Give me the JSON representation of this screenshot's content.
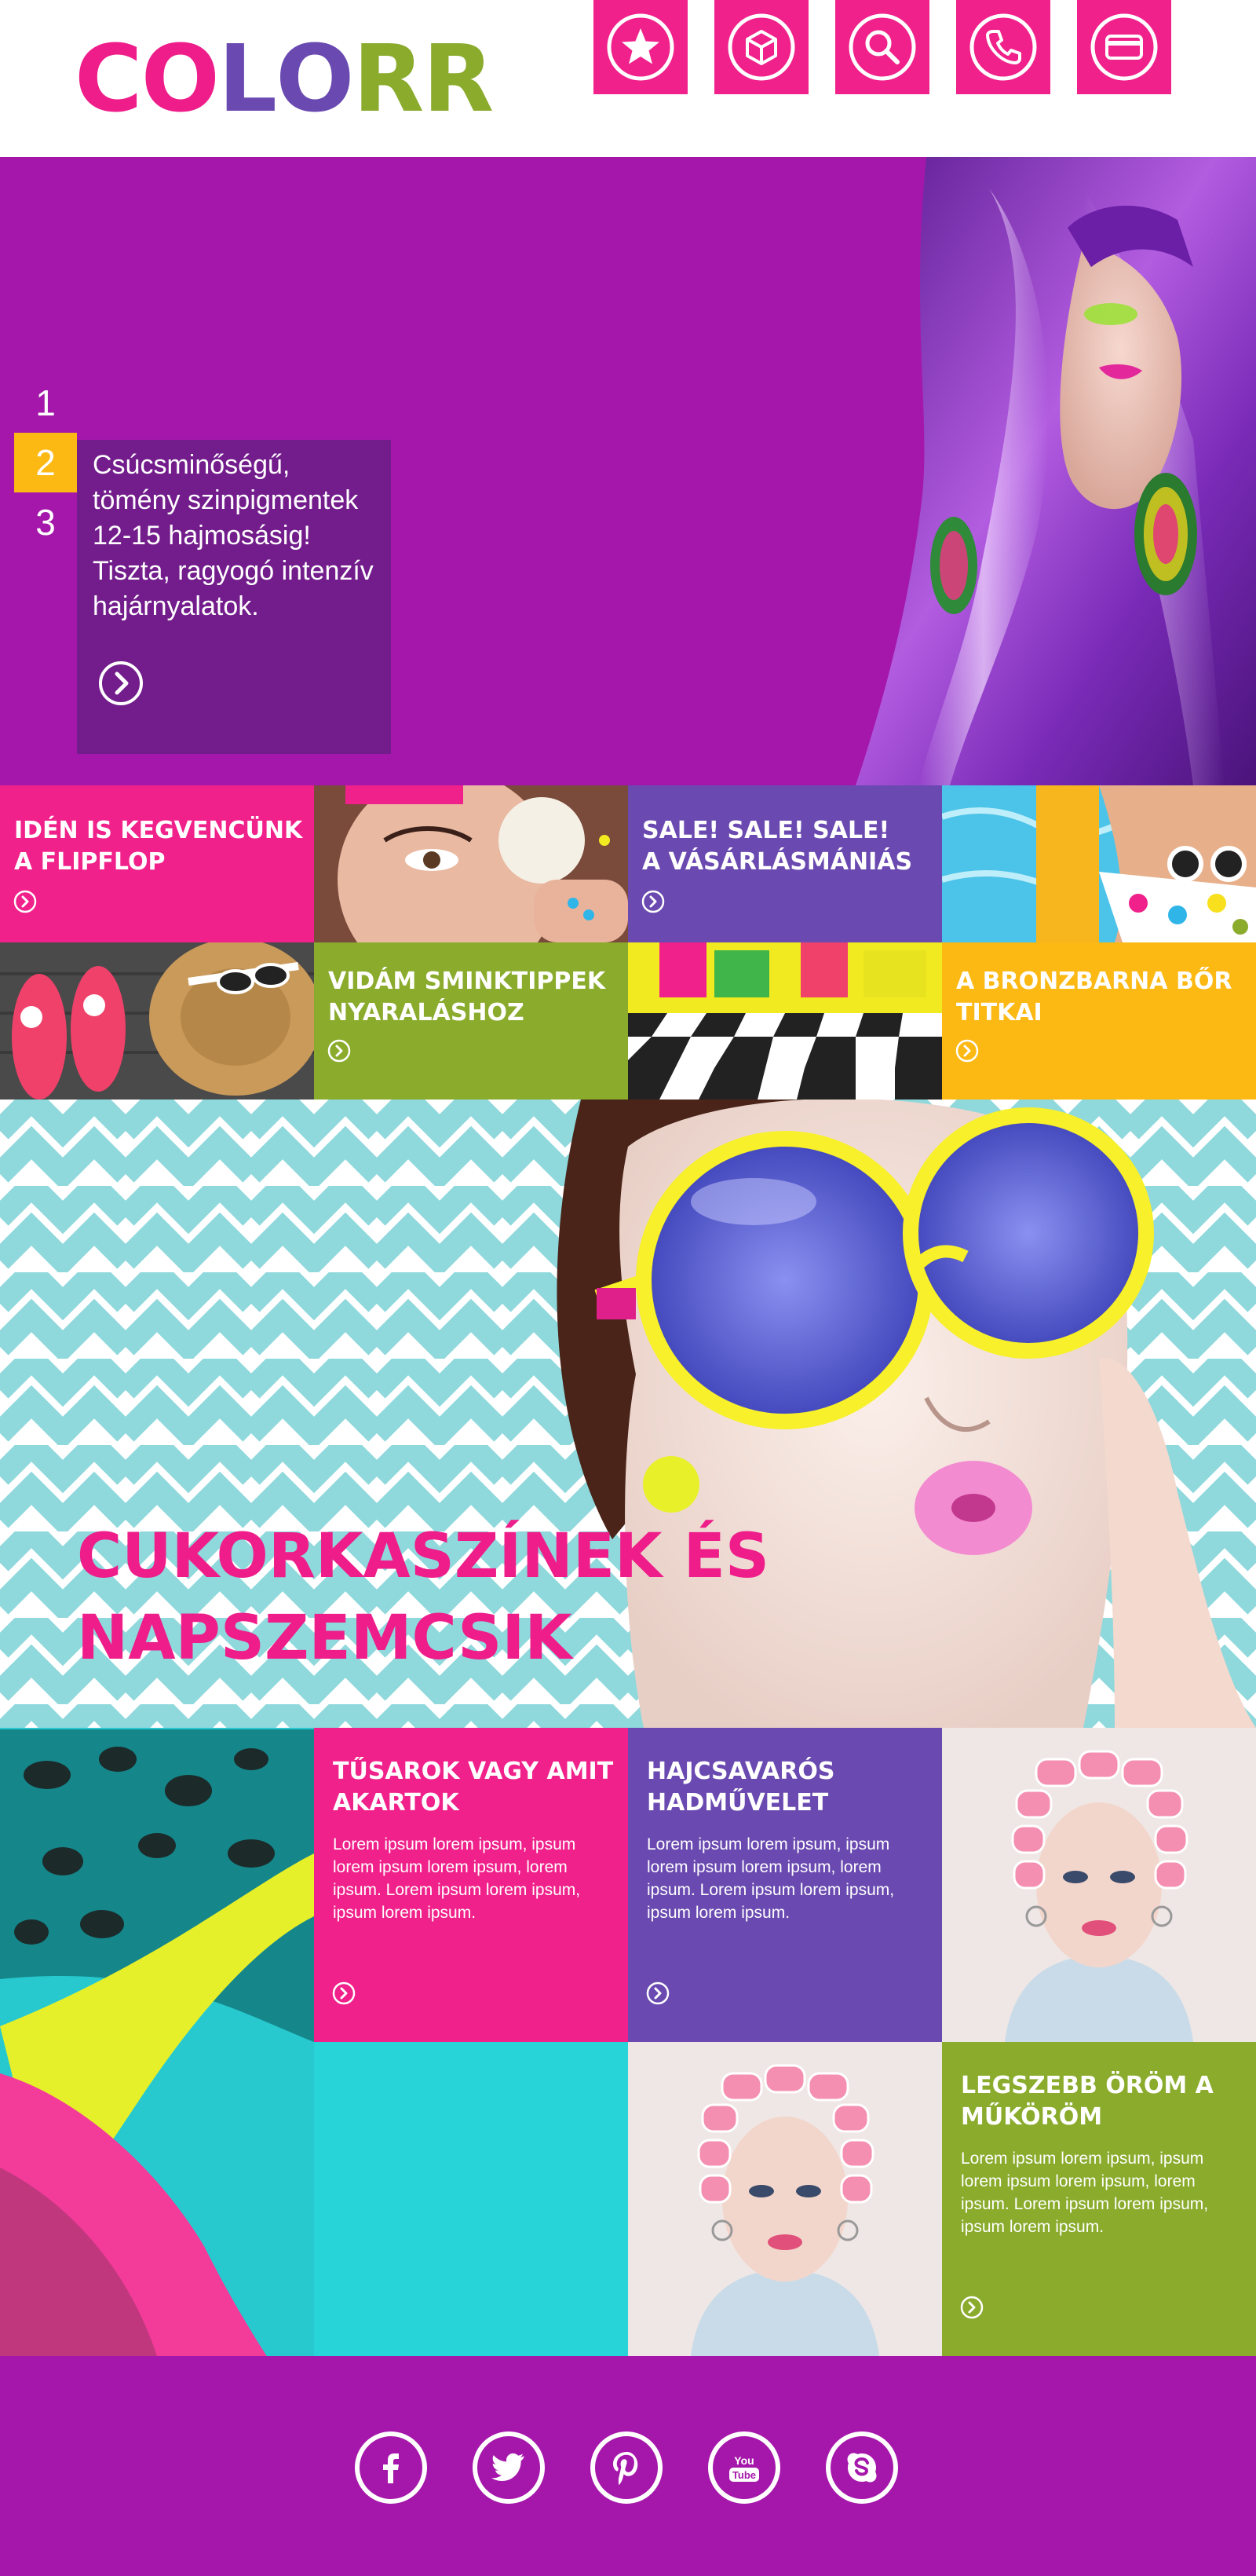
{
  "header": {
    "logo_letters": [
      {
        "char": "C",
        "color": "#ee1d8a"
      },
      {
        "char": "O",
        "color": "#ee1d8a"
      },
      {
        "char": "L",
        "color": "#6a4ab0"
      },
      {
        "char": "O",
        "color": "#6a4ab0"
      },
      {
        "char": "R",
        "color": "#8aab2c"
      },
      {
        "char": "R",
        "color": "#8aab2c"
      }
    ],
    "nav_icons": [
      "star-icon",
      "box-icon",
      "search-icon",
      "phone-icon",
      "card-icon"
    ]
  },
  "hero": {
    "slides": [
      "1",
      "2",
      "3"
    ],
    "active_slide": "2",
    "text": "Csúcsminőségű, tömény szinpigmentek 12-15 hajmosásig! Tiszta, ragyogó intenzív hajárnyalatok."
  },
  "tiles": [
    {
      "title_1": "IDÉN IS KEGVENCÜNK",
      "title_2": "A FLIPFLOP",
      "color": "#f0218a"
    },
    {
      "title_1": "SALE! SALE! SALE!",
      "title_2": "A VÁSÁRLÁSMÁNIÁS",
      "color": "#6a4ab0"
    },
    {
      "title_1": "VIDÁM SMINKTIPPEK",
      "title_2": "NYARALÁSHOZ",
      "color": "#8aab2c"
    },
    {
      "title_1": "A BRONZBARNA BŐR",
      "title_2": "TITKAI",
      "color": "#fcb813"
    }
  ],
  "banner": {
    "title_1": "CUKORKASZÍNEK ÉS",
    "title_2": "NAPSZEMCSIK"
  },
  "grid": [
    {
      "title": "TŰSAROK VAGY AMIT AKARTOK",
      "body": "Lorem ipsum lorem ipsum, ipsum lorem ipsum lorem ipsum, lorem ipsum. Lorem ipsum lorem ipsum, ipsum lorem ipsum.",
      "color": "#f0218a"
    },
    {
      "title": "HAJCSAVARÓS HADMŰVELET",
      "body": "Lorem ipsum lorem ipsum, ipsum lorem ipsum lorem ipsum, lorem ipsum. Lorem ipsum lorem ipsum, ipsum lorem ipsum.",
      "color": "#6a4ab0"
    },
    {
      "title": "LEGSZEBB ÖRÖM A MŰKÖRÖM",
      "body": "Lorem ipsum lorem ipsum, ipsum lorem ipsum lorem ipsum, lorem ipsum. Lorem ipsum lorem ipsum, ipsum lorem ipsum.",
      "color": "#8aab2c"
    }
  ],
  "footer": {
    "socials": [
      "facebook-icon",
      "twitter-icon",
      "pinterest-icon",
      "youtube-icon",
      "skype-icon"
    ],
    "youtube_text_1": "You",
    "youtube_text_2": "Tube"
  },
  "colors": {
    "purple": "#a517aa",
    "dark_purple": "#731c8c",
    "pink": "#f0218a",
    "violet": "#6a4ab0",
    "green": "#8aab2c",
    "yellow": "#fcb813",
    "turquoise": "#8fd8dc"
  }
}
